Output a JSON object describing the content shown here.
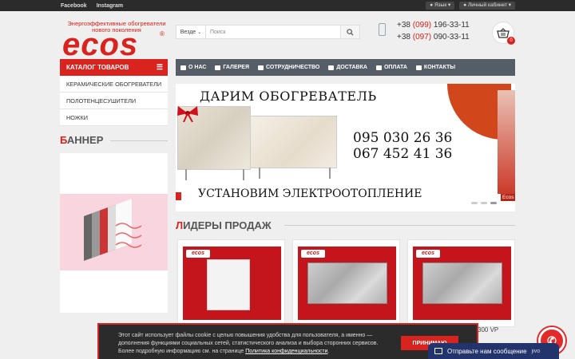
{
  "topbar": {
    "links": [
      "Facebook",
      "Instagram"
    ],
    "language_label": "Язык",
    "account_label": "Личный кабинет"
  },
  "header": {
    "slogan": "Энергоэффективные обогреватели нового поколения",
    "logo": "ecos",
    "search_scope": "Везде",
    "search_placeholder": "Поиск",
    "phones": [
      {
        "prefix": "+38 ",
        "code": "(099)",
        "number": " 196-33-11"
      },
      {
        "prefix": "+38 ",
        "code": "(097)",
        "number": " 090-33-11"
      }
    ],
    "cart_count": "0"
  },
  "catalog": {
    "title": "КАТАЛОГ ТОВАРОВ",
    "items": [
      "КЕРАМИЧЕСКИЕ ОБОГРЕВАТЕЛИ",
      "ПОЛОТЕНЦЕСУШИТЕЛИ",
      "НОЖКИ"
    ]
  },
  "nav": {
    "items": [
      {
        "label": "О НАС",
        "icon": "home-icon"
      },
      {
        "label": "ГАЛЕРЕЯ",
        "icon": "image-icon"
      },
      {
        "label": "СОТРУДНИЧЕСТВО",
        "icon": "users-icon"
      },
      {
        "label": "ДОСТАВКА",
        "icon": "truck-icon"
      },
      {
        "label": "ОПЛАТА",
        "icon": "credit-card-icon"
      },
      {
        "label": "КОНТАКТЫ",
        "icon": "envelope-icon"
      }
    ]
  },
  "banner_section": {
    "first_letter": "Б",
    "rest": "АННЕР"
  },
  "slider": {
    "title": "ДАРИМ ОБОГРЕВАТЕЛЬ",
    "numbers": [
      "095 030 26 36",
      "067 452 41 36"
    ],
    "bottom": "УСТАНОВИМ ЭЛЕКТРООТОПЛЕНИЕ",
    "thumb_label": "Ecos",
    "active_dot": 2
  },
  "leaders_section": {
    "first_letter": "Л",
    "rest": "ИДЕРЫ ПРОДАЖ"
  },
  "products": [
    {
      "brand": "ecos",
      "style": "white"
    },
    {
      "brand": "ecos",
      "style": "grey"
    },
    {
      "brand": "ecos",
      "style": "grey"
    }
  ],
  "price_fragment": "300 VP",
  "cookie": {
    "text": "Этот сайт использует файлы cookie с целью повышения удобства для пользователя, а именно — дополнения функциями социальных сетей, статистического анализа и выбора сторонних сервисов. Более подробную информацию см. на странице ",
    "link": "Политика конфиденциальности",
    "suffix": ".",
    "accept": "ПРИНИМАЮ"
  },
  "chat": {
    "label": "Отправьте нам сообщение",
    "brand": "jivo"
  }
}
